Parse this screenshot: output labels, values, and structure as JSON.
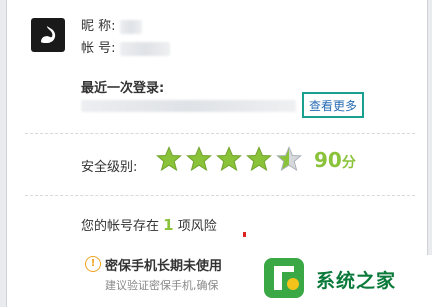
{
  "profile": {
    "nickname_label": "昵 称:",
    "account_label": "帐 号:",
    "last_login_label": "最近一次登录:",
    "more_button": "查看更多"
  },
  "security": {
    "level_label": "安全级别:",
    "stars_rating": 4.5,
    "stars_total": 5,
    "score_value": "90",
    "score_unit": "分",
    "risk_prefix": "您的帐号存在",
    "risk_count": "1",
    "risk_suffix": "项风险",
    "warning_title": "密保手机长期未使用",
    "warning_desc": "建议验证密保手机,确保"
  },
  "watermark": {
    "text": "系统之家"
  },
  "colors": {
    "accent_green": "#8ac23a",
    "teal_border": "#1b9f8e",
    "link_blue": "#2a6db5",
    "warning_orange": "#f1a323"
  }
}
